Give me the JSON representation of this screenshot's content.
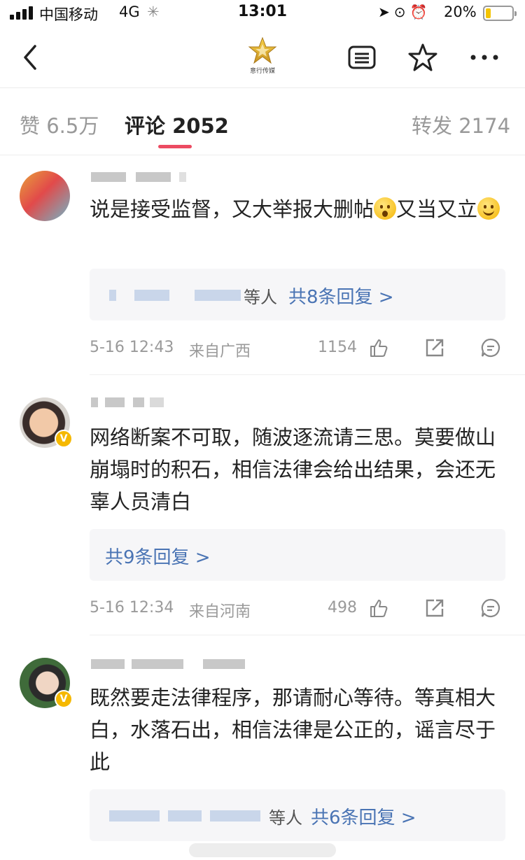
{
  "status_bar": {
    "carrier": "中国移动",
    "network": "4G",
    "time": "13:01",
    "battery_percent": "20%",
    "battery_level": 0.2,
    "battery_color": "#f4c400"
  },
  "nav": {
    "logo_text": "意行传媒",
    "icons": [
      "back-arrow-icon",
      "article-icon",
      "star-icon",
      "more-icon"
    ]
  },
  "tabs": [
    {
      "label": "赞 6.5万",
      "active": false
    },
    {
      "label": "评论 2052",
      "active": true
    },
    {
      "label": "转发 2174",
      "active": false
    }
  ],
  "accent_color": "#ec4b62",
  "link_color": "#4a74b4",
  "comments": [
    {
      "text": "说是接受监督，又大举报大删帖",
      "text_emoji": "shock-emoji",
      "text_after": "又当又立",
      "text_end_emoji": "smile-emoji",
      "reply_suffix": "等人",
      "reply_count": "共8条回复 >",
      "time": "5-16 12:43",
      "location": "来自广西",
      "likes": "1154",
      "verified": false
    },
    {
      "text": "网络断案不可取，随波逐流请三思。莫要做山崩塌时的积石，相信法律会给出结果，会还无辜人员清白",
      "reply_suffix": "",
      "reply_count": "共9条回复 >",
      "time": "5-16 12:34",
      "location": "来自河南",
      "likes": "498",
      "verified": true
    },
    {
      "text": "既然要走法律程序，那请耐心等待。等真相大白，水落石出，相信法律是公正的，谣言尽于此",
      "reply_suffix": "等人",
      "reply_count": "共6条回复 >",
      "verified": true
    }
  ]
}
